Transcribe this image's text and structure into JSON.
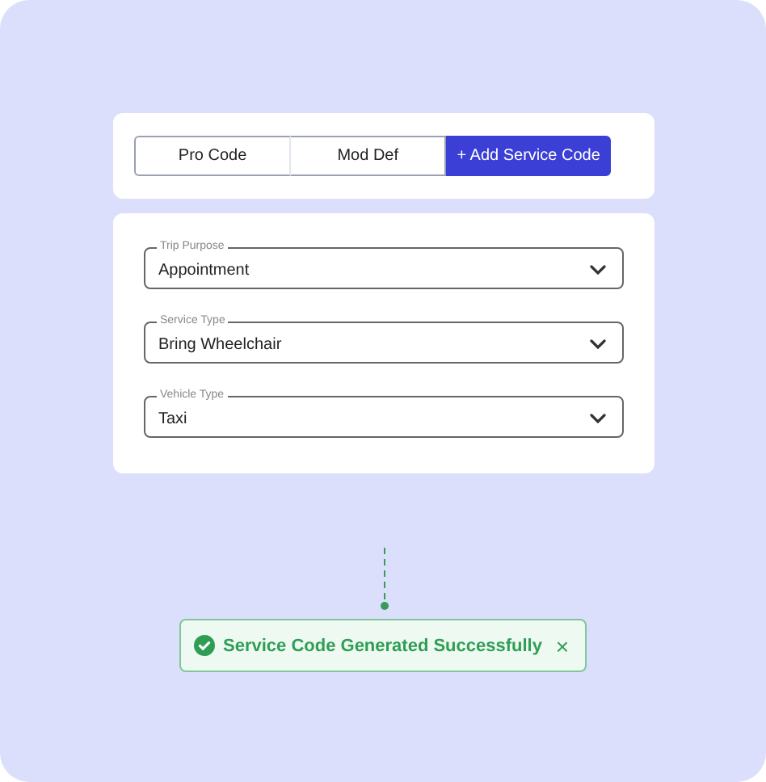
{
  "tabs": [
    {
      "label": "Pro Code",
      "selected": false
    },
    {
      "label": "Mod Def",
      "selected": false
    },
    {
      "label": "+ Add Service Code",
      "selected": true
    }
  ],
  "fields": [
    {
      "label": "Trip Purpose",
      "value": "Appointment"
    },
    {
      "label": "Service Type",
      "value": "Bring Wheelchair"
    },
    {
      "label": "Vehicle Type",
      "value": "Taxi"
    }
  ],
  "toast": {
    "message": "Service Code Generated Successfully",
    "close": "×"
  }
}
